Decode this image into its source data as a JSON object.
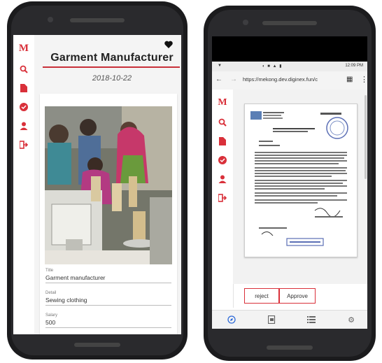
{
  "colors": {
    "accent": "#d9303a",
    "active_nav": "#2f6bd8"
  },
  "left_phone": {
    "sidebar": {
      "logo": "M",
      "items": [
        {
          "icon": "search-icon"
        },
        {
          "icon": "document-icon"
        },
        {
          "icon": "check-circle-icon"
        },
        {
          "icon": "user-icon"
        },
        {
          "icon": "logout-icon"
        }
      ]
    },
    "page_title": "Garment Manufacturer",
    "favorite_icon": "heart-icon",
    "date": "2018-10-22",
    "fields": [
      {
        "label": "Title",
        "value": "Garment manufacturer"
      },
      {
        "label": "Detail",
        "value": "Sewing clothing"
      },
      {
        "label": "Salary",
        "value": "500"
      }
    ]
  },
  "right_phone": {
    "status": {
      "time": "12:09 PM"
    },
    "browser": {
      "url": "https://mekong.dev.diginex.fun/c"
    },
    "sidebar": {
      "logo": "M",
      "items": [
        {
          "icon": "search-icon"
        },
        {
          "icon": "document-icon"
        },
        {
          "icon": "check-circle-icon"
        },
        {
          "icon": "user-icon"
        },
        {
          "icon": "logout-icon"
        }
      ]
    },
    "actions": {
      "reject": "reject",
      "approve": "Approve"
    },
    "bottom_nav": [
      {
        "icon": "compass-icon",
        "active": true
      },
      {
        "icon": "document-icon",
        "active": false
      },
      {
        "icon": "list-icon",
        "active": false
      },
      {
        "icon": "gear-icon",
        "active": false
      }
    ]
  }
}
